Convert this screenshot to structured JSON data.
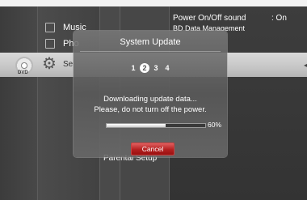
{
  "menu": {
    "items": [
      {
        "label": "Music",
        "icon": "music-note-icon"
      },
      {
        "label": "Pho",
        "icon": "photo-icon"
      },
      {
        "label": "Se",
        "icon": "settings-gear-icon"
      }
    ],
    "disc_label": "DVD",
    "parental_setup": "Parental Setup"
  },
  "settings_panel": {
    "power_sound_label": "Power On/Off sound",
    "power_sound_value": ": On",
    "bd_data_label": "BD Data Management"
  },
  "dialog": {
    "title": "System Update",
    "steps": [
      "1",
      "2",
      "3",
      "4"
    ],
    "active_step": 2,
    "message_line1": "Downloading update data...",
    "message_line2": "Please, do not turn off the power.",
    "progress": 0.6,
    "progress_text": "60%",
    "cancel_label": "Cancel"
  },
  "colors": {
    "cancel_button": "#b52020",
    "dialog_background": "#6e6e6e"
  }
}
